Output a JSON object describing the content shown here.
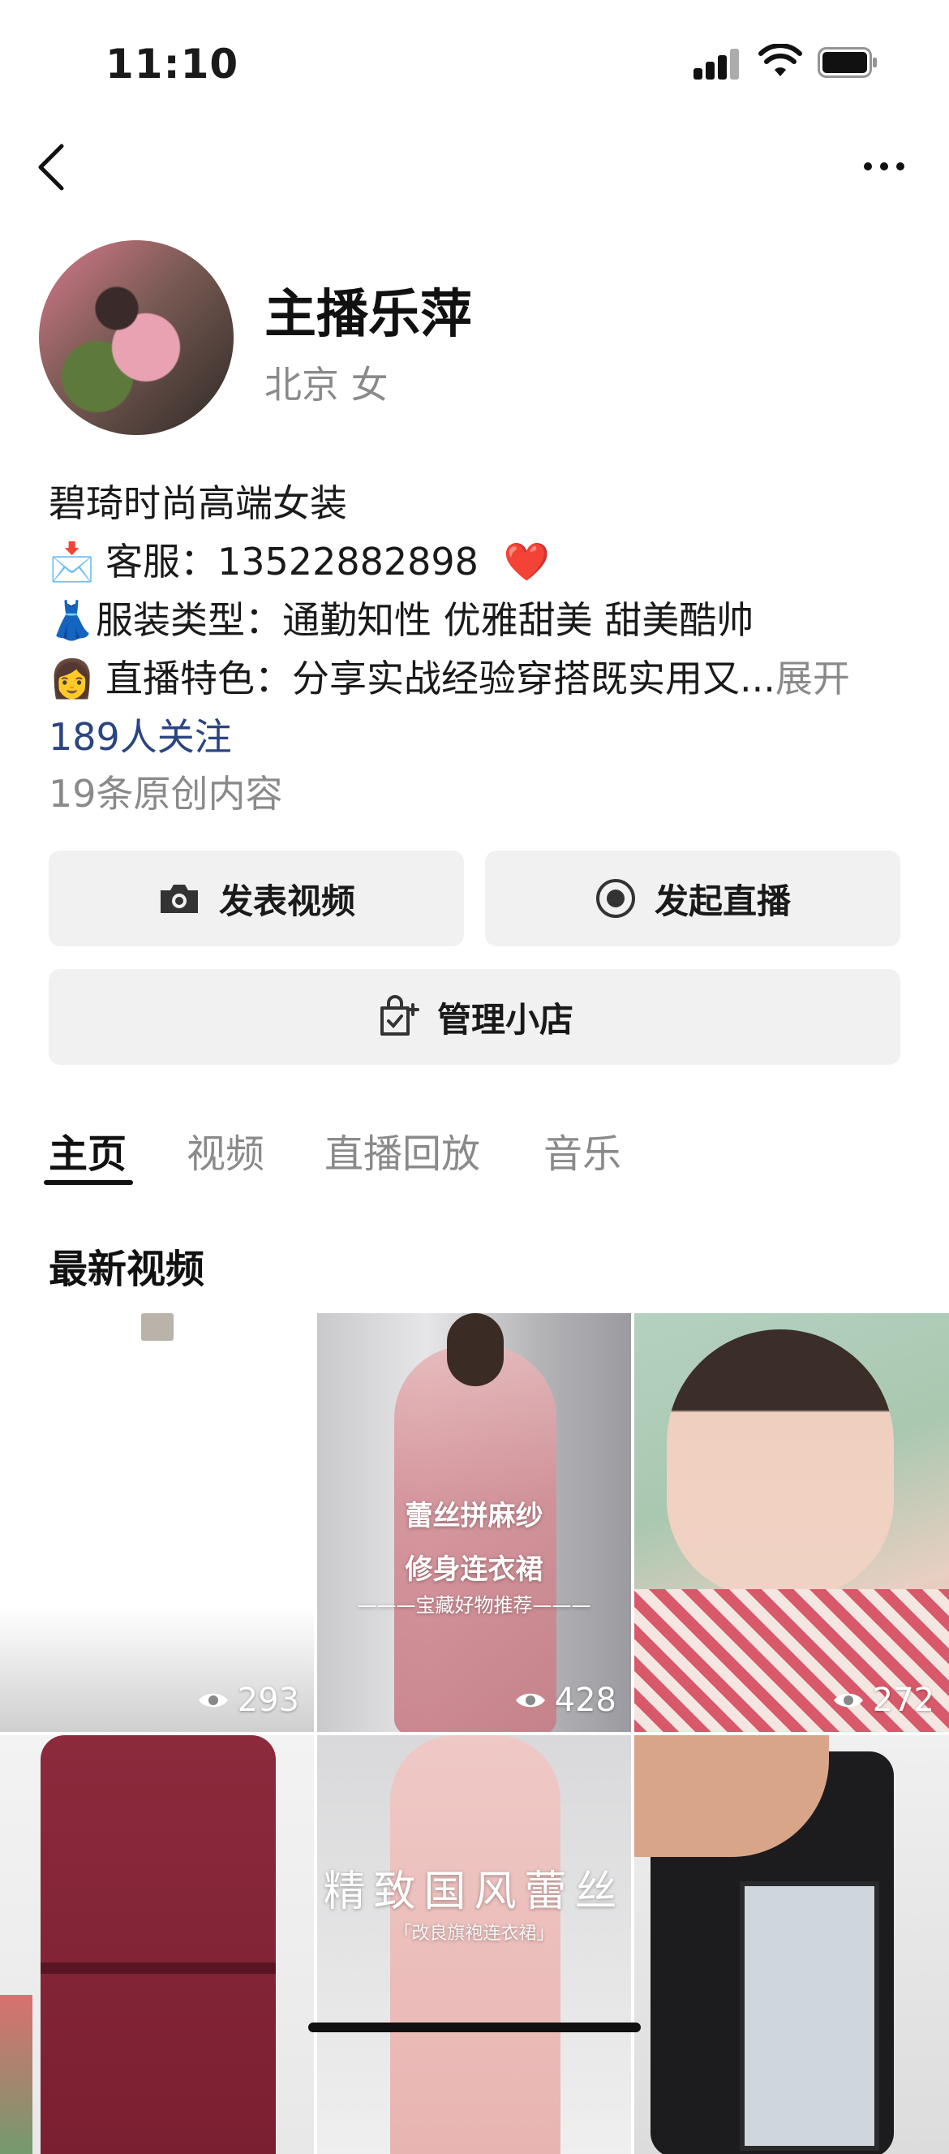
{
  "status_bar": {
    "time": "11:10"
  },
  "profile": {
    "name": "主播乐萍",
    "meta": "北京 女",
    "bio": {
      "line1": "碧琦时尚高端女装",
      "line2_emoji": "📩",
      "line2": "客服：13522882898",
      "line2_emoji_end": "❤️",
      "line3_emoji": "👗",
      "line3": "服装类型：通勤知性  优雅甜美  甜美酷帅",
      "line4_emoji": "👩",
      "line4": "直播特色：分享实战经验穿搭既实用又...",
      "expand": "展开"
    },
    "followers": "189人关注",
    "original_count": "19条原创内容"
  },
  "actions": {
    "post_video": "发表视频",
    "start_live": "发起直播",
    "manage_shop": "管理小店"
  },
  "tabs": [
    {
      "label": "主页",
      "active": true
    },
    {
      "label": "视频",
      "active": false
    },
    {
      "label": "直播回放",
      "active": false
    },
    {
      "label": "音乐",
      "active": false
    }
  ],
  "section": {
    "latest_videos": "最新视频"
  },
  "videos": [
    {
      "views": "293",
      "overlay": []
    },
    {
      "views": "428",
      "overlay": [
        "蕾丝拼麻纱",
        "修身连衣裙",
        "———宝藏好物推荐———"
      ]
    },
    {
      "views": "272",
      "overlay": []
    },
    {
      "views": "",
      "overlay": []
    },
    {
      "views": "",
      "overlay": [
        "精致国风蕾丝",
        "「改良旗袍连衣裙」"
      ]
    },
    {
      "views": "",
      "overlay": []
    }
  ],
  "colors": {
    "accent_link": "#2a4580",
    "muted": "#8a8a8a",
    "button_bg": "#f1f1f2"
  }
}
